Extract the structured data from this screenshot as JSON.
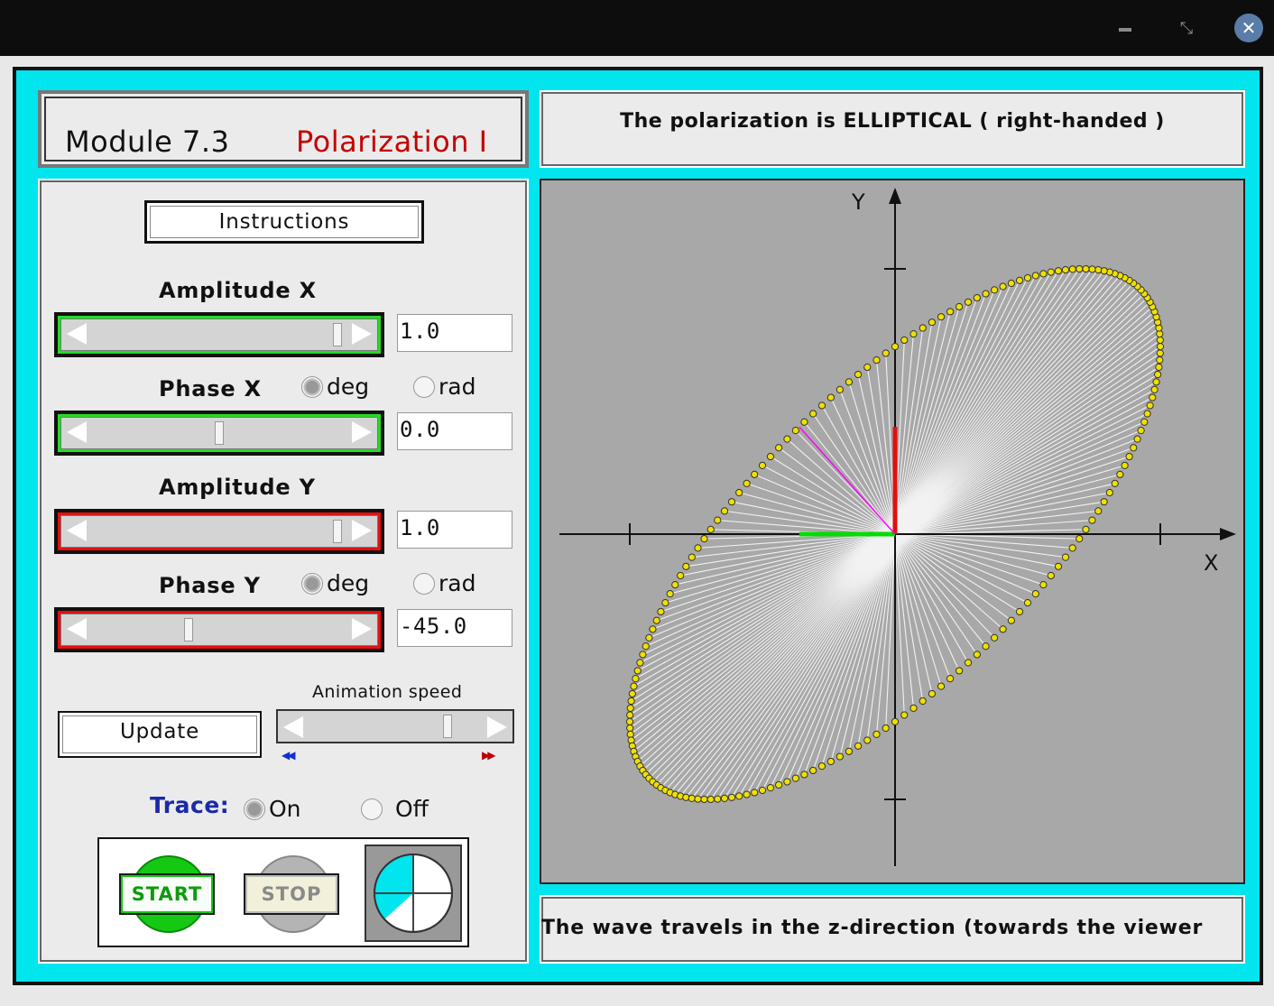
{
  "window": {
    "close_symbol": "✕",
    "restore_symbol": "⤡"
  },
  "header": {
    "module_label": "Module 7.3",
    "module_name": "Polarization I"
  },
  "status": {
    "text": "The polarization is ELLIPTICAL ( right-handed )"
  },
  "footer": {
    "text": "The wave travels in the z-direction (towards the viewer"
  },
  "controls": {
    "instructions_label": "Instructions",
    "amplitude_x": {
      "label": "Amplitude X",
      "value": "1.0",
      "slider_fraction": 0.98
    },
    "phase_x": {
      "label": "Phase X",
      "value": "0.0",
      "unit_deg": "deg",
      "unit_rad": "rad",
      "selected_unit": "deg",
      "slider_fraction": 0.5
    },
    "amplitude_y": {
      "label": "Amplitude Y",
      "value": "1.0",
      "slider_fraction": 0.98
    },
    "phase_y": {
      "label": "Phase Y",
      "value": "-45.0",
      "unit_deg": "deg",
      "unit_rad": "rad",
      "selected_unit": "deg",
      "slider_fraction": 0.375
    },
    "update_label": "Update",
    "animation_speed": {
      "label": "Animation speed",
      "slow_icon": "◀◀",
      "fast_icon": "▶▶",
      "fraction": 0.82
    },
    "trace": {
      "label": "Trace:",
      "on_label": "On",
      "off_label": "Off",
      "selected": "on"
    },
    "start_label": "START",
    "stop_label": "STOP"
  },
  "plot": {
    "x_axis_label": "X",
    "y_axis_label": "Y",
    "amplitude_x": 1.0,
    "amplitude_y": 1.0,
    "phase_x_deg": 0.0,
    "phase_y_deg": -45.0,
    "handedness": "right-handed",
    "colors": {
      "trace_dot": "#f0e000",
      "x_component": "#00dd00",
      "y_component": "#e01010",
      "field_vector": "#ff00ff",
      "background": "#a8a8a8"
    }
  }
}
